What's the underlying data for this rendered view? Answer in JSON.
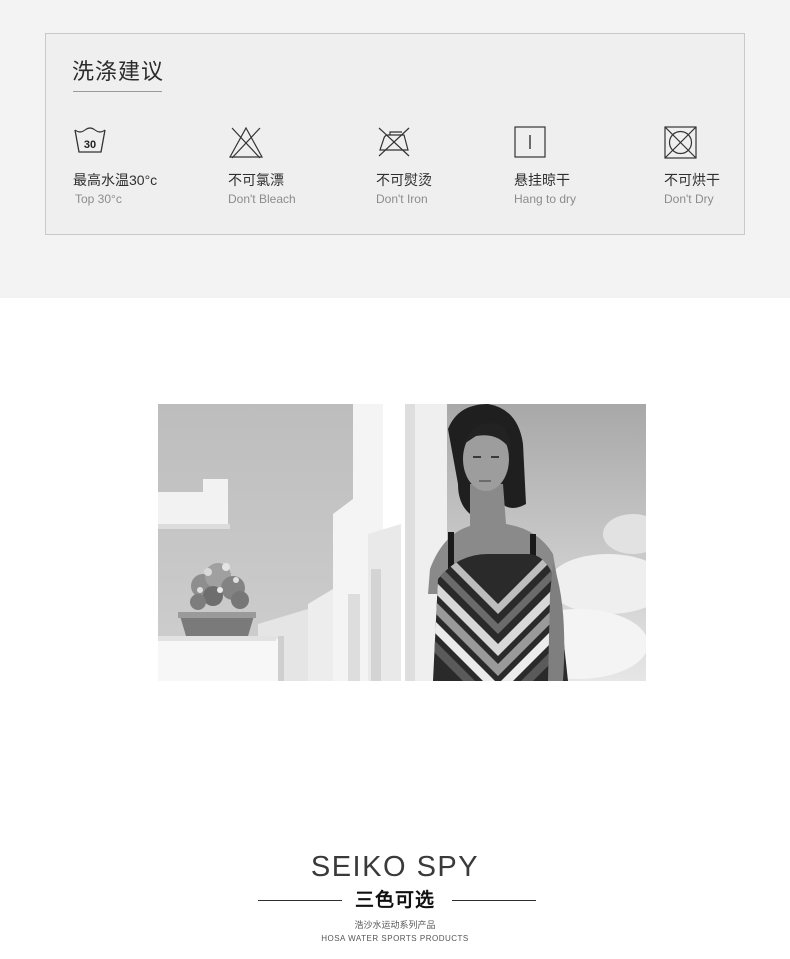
{
  "care": {
    "title": "洗涤建议",
    "items": [
      {
        "icon": "wash-30-icon",
        "cn": "最高水温30°c",
        "en": "Top 30°c",
        "icon_text": "30"
      },
      {
        "icon": "no-bleach-icon",
        "cn": "不可氯漂",
        "en": "Don't Bleach"
      },
      {
        "icon": "no-iron-icon",
        "cn": "不可熨烫",
        "en": "Don't Iron"
      },
      {
        "icon": "hang-dry-icon",
        "cn": "悬挂晾干",
        "en": "Hang to dry"
      },
      {
        "icon": "no-tumble-dry-icon",
        "cn": "不可烘干",
        "en": "Don't Dry"
      }
    ]
  },
  "brand": {
    "name": "SEIKO SPY",
    "colors_label": "三色可选",
    "sub_cn": "浩沙水运动系列产品",
    "sub_en": "HOSA WATER SPORTS PRODUCTS"
  }
}
